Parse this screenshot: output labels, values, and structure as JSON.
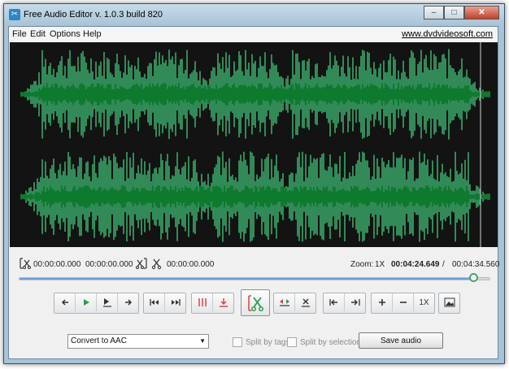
{
  "window": {
    "title": "Free Audio Editor v. 1.0.3 build 820",
    "controls": {
      "minimize": "–",
      "maximize": "□",
      "close": "✕"
    }
  },
  "menu": {
    "items": [
      "File",
      "Edit",
      "Options",
      "Help"
    ],
    "site_link": "www.dvdvideosoft.com"
  },
  "timeline": {
    "selection_start": "00:00:00.000",
    "selection_end": "00:00:00.000",
    "cut_position": "00:00:00.000",
    "zoom_label": "Zoom:",
    "zoom_value": "1X",
    "current_time": "00:04:24.649",
    "separator": "/",
    "total_time": "00:04:34.560",
    "playback_progress": 0.965
  },
  "toolbar": {
    "zoom_reset_label": "1X"
  },
  "bottom": {
    "format_selected": "Convert to AAC",
    "split_by_tags": "Split by tags",
    "split_by_selections": "Split by selections",
    "save_label": "Save audio"
  },
  "colors": {
    "waveform": "#3ba86a",
    "waveform_core": "#0e7a2e",
    "background": "#131313",
    "accent": "#4aa36a"
  }
}
